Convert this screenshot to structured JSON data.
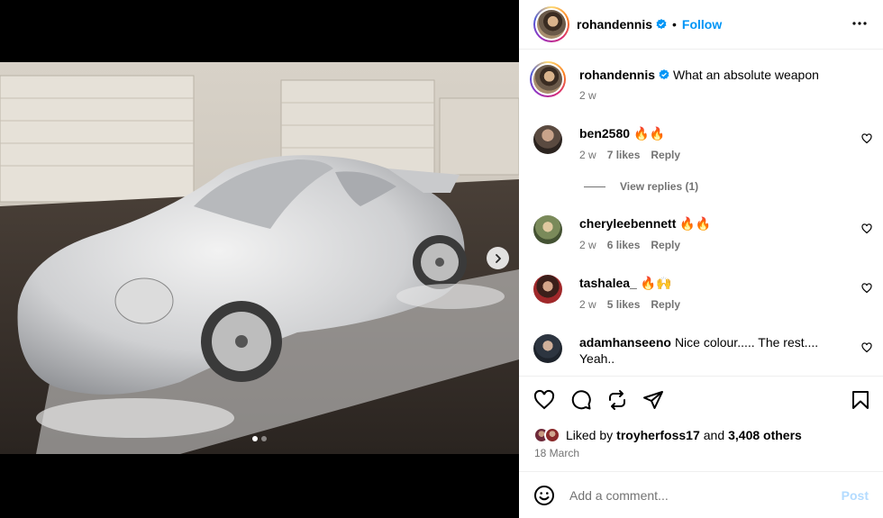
{
  "post": {
    "author": "rohandennis",
    "follow_label": "Follow",
    "separator": "•",
    "caption": "What an absolute weapon",
    "caption_age": "2 w",
    "verified": true
  },
  "media": {
    "slide_count": 2,
    "active_slide": 1,
    "next_icon": "chevron-right-icon"
  },
  "comments": [
    {
      "username": "ben2580",
      "text": "🔥🔥",
      "age": "2 w",
      "likes": "7 likes",
      "reply_label": "Reply",
      "view_replies": "View replies (1)"
    },
    {
      "username": "cheryleebennett",
      "text": "🔥🔥",
      "age": "2 w",
      "likes": "6 likes",
      "reply_label": "Reply"
    },
    {
      "username": "tashalea_",
      "text": "🔥🙌",
      "age": "2 w",
      "likes": "5 likes",
      "reply_label": "Reply"
    },
    {
      "username": "adamhanseeno",
      "text": "Nice colour..... The rest.... Yeah..",
      "age": "",
      "likes": "",
      "reply_label": ""
    }
  ],
  "actions": {
    "icons": [
      "heart-icon",
      "comment-icon",
      "repost-icon",
      "share-icon",
      "bookmark-icon"
    ]
  },
  "likes": {
    "prefix": "Liked by",
    "liker": "troyherfoss17",
    "and": "and",
    "others": "3,408 others"
  },
  "date": "18 March",
  "composer": {
    "placeholder": "Add a comment...",
    "post_label": "Post"
  },
  "colors": {
    "link_blue": "#0095f6",
    "post_disabled": "#b3dbff",
    "muted": "#737373",
    "verified_blue": "#0095f6"
  }
}
